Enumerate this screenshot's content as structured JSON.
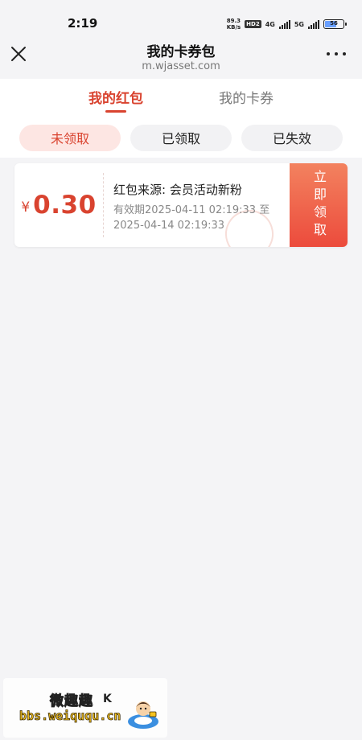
{
  "status_bar": {
    "time": "2:19",
    "net_speed_value": "89.3",
    "net_speed_unit": "KB/s",
    "hd_badge": "HD2",
    "net1": "4G",
    "net2": "5G",
    "battery": "56"
  },
  "nav": {
    "title": "我的卡券包",
    "url": "m.wjasset.com",
    "close_icon": "close-icon",
    "more_icon": "more-icon"
  },
  "tabs": [
    {
      "label": "我的红包",
      "active": true
    },
    {
      "label": "我的卡券",
      "active": false
    }
  ],
  "filters": [
    {
      "label": "未领取",
      "active": true
    },
    {
      "label": "已领取",
      "active": false
    },
    {
      "label": "已失效",
      "active": false
    }
  ],
  "coupon": {
    "currency": "¥",
    "amount": "0.30",
    "source": "红包来源: 会员活动新粉",
    "validity_line1": "有效期2025-04-11 02:19:33 至",
    "validity_line2": "2025-04-14 02:19:33",
    "claim_label": "立即领取"
  },
  "watermark": {
    "title": "微趣趣",
    "k": "K",
    "url": "bbs.weiququ.cn"
  },
  "colors": {
    "accent": "#d9432f",
    "claim_gradient_top": "#f3825f",
    "claim_gradient_bottom": "#ec4b3c",
    "chip_active_bg": "#fde6e3"
  }
}
